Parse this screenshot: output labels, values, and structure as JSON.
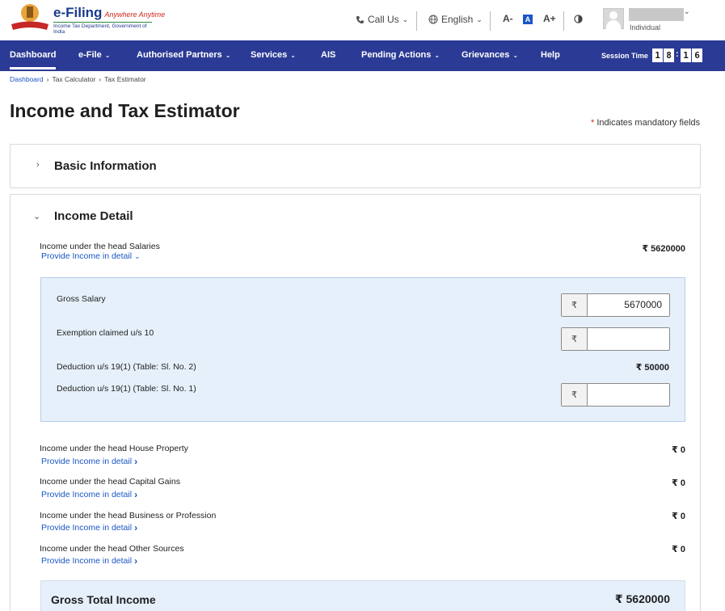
{
  "header": {
    "logo_title": "e-Filing",
    "logo_tagline": "Anywhere Anytime",
    "logo_subtitle": "Income Tax Department, Government of India",
    "call_us": "Call Us",
    "language": "English",
    "font_decrease": "A-",
    "font_normal": "A",
    "font_increase": "A+",
    "user_role": "Individual"
  },
  "nav": {
    "items": [
      {
        "label": "Dashboard"
      },
      {
        "label": "e-File"
      },
      {
        "label": "Authorised Partners"
      },
      {
        "label": "Services"
      },
      {
        "label": "AIS"
      },
      {
        "label": "Pending Actions"
      },
      {
        "label": "Grievances"
      },
      {
        "label": "Help"
      }
    ],
    "session_label": "Session Time",
    "session_digits": [
      "1",
      "8",
      "1",
      "6"
    ]
  },
  "breadcrumb": [
    "Dashboard",
    "Tax Calculator",
    "Tax Estimator"
  ],
  "page": {
    "title": "Income and Tax Estimator",
    "mandatory_star": "*",
    "mandatory_note": "Indicates mandatory fields"
  },
  "basic_info": {
    "title": "Basic Information"
  },
  "income_detail": {
    "title": "Income Detail",
    "salaries": {
      "label": "Income under the head Salaries",
      "link": "Provide Income in detail",
      "value": "₹ 5620000"
    },
    "salary_panel": {
      "gross_salary_label": "Gross Salary",
      "gross_salary_value": "5670000",
      "exemption_label": "Exemption claimed u/s 10",
      "exemption_value": "",
      "deduction2_label": "Deduction u/s 19(1) (Table: Sl. No. 2)",
      "deduction2_value": "₹ 50000",
      "deduction1_label": "Deduction u/s 19(1) (Table: Sl. No. 1)",
      "deduction1_value": "",
      "rupee": "₹"
    },
    "heads": [
      {
        "label": "Income under the head House Property",
        "link": "Provide Income in detail",
        "value": "₹ 0"
      },
      {
        "label": "Income under the head Capital Gains",
        "link": "Provide Income in detail",
        "value": "₹ 0"
      },
      {
        "label": "Income under the head Business or Profession",
        "link": "Provide Income in detail",
        "value": "₹ 0"
      },
      {
        "label": "Income under the head Other Sources",
        "link": "Provide Income in detail",
        "value": "₹ 0"
      }
    ],
    "gross_total": {
      "label": "Gross Total Income",
      "value": "₹ 5620000"
    }
  },
  "colors": {
    "nav_bg": "#2b3a94",
    "link": "#1a56c5",
    "panel_bg": "#e6f0fb"
  }
}
